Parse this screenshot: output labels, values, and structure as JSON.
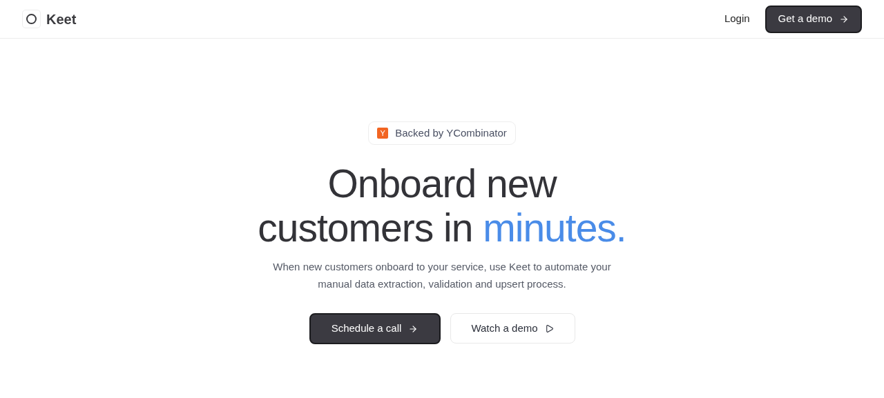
{
  "nav": {
    "brand": "Keet",
    "login": "Login",
    "cta": "Get a demo"
  },
  "badge": {
    "logo_letter": "Y",
    "text": "Backed by YCombinator"
  },
  "hero": {
    "line1": "Onboard new",
    "line2": "customers in",
    "highlight": "minutes.",
    "subtitle": "When new customers onboard to your service, use Keet to automate your manual data extraction, validation and upsert process."
  },
  "buttons": [
    {
      "kind": "primary",
      "label": "Schedule a call"
    },
    {
      "kind": "secondary",
      "label": "Watch a demo"
    }
  ]
}
